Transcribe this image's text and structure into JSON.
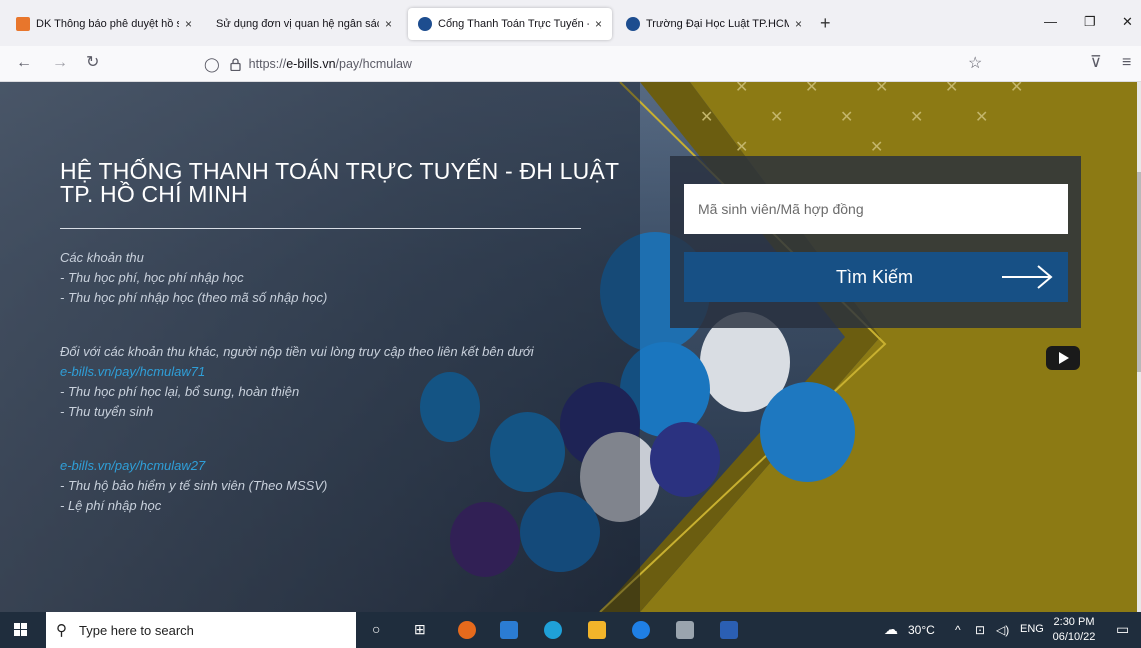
{
  "browser": {
    "tabs": [
      {
        "title": "DK Thông báo phê duyệt hồ sơ",
        "active": false
      },
      {
        "title": "Sử dụng đơn vị quan hệ ngân sách/",
        "active": false
      },
      {
        "title": "Cổng Thanh Toán Trực Tuyến - T",
        "active": true
      },
      {
        "title": "Trường Đại Học Luật TP.HCM",
        "active": false
      }
    ],
    "tab_close": "×",
    "new_tab": "+",
    "url_host": "https://e-bills.vn",
    "url_path": "/pay/hcmulaw",
    "url_scheme": "https://",
    "url_domain": "e-bills.vn"
  },
  "page": {
    "title_line1": "HỆ THỐNG THANH TOÁN TRỰC TUYẾN - ĐH LUẬT",
    "title_line2": "TP. HỒ CHÍ MINH",
    "section1_heading": "Các khoản thu",
    "section1_items": [
      "- Thu học phí, học phí nhập học",
      "- Thu học phí nhập học (theo mã số nhập học)"
    ],
    "other_notice": "Đối với các khoản thu khác, người nộp tiền vui lòng truy cập theo liên kết bên dưới",
    "link1": "e-bills.vn/pay/hcmulaw71",
    "link1_items": [
      "- Thu học phí học lại, bổ sung, hoàn thiện",
      "- Thu tuyển sinh"
    ],
    "link2": "e-bills.vn/pay/hcmulaw27",
    "link2_items": [
      "- Thu hộ bảo hiểm y tế sinh viên (Theo MSSV)",
      "- Lệ phí nhập học"
    ],
    "search_placeholder": "Mã sinh viên/Mã hợp đồng",
    "search_button": "Tìm Kiếm"
  },
  "taskbar": {
    "search_placeholder": "Type here to search",
    "weather": "30°C",
    "language": "ENG",
    "time": "2:30 PM",
    "date": "06/10/22"
  },
  "colors": {
    "button_blue": "#175085",
    "link_blue": "#2f9fd8",
    "gold": "#8c7a14"
  }
}
